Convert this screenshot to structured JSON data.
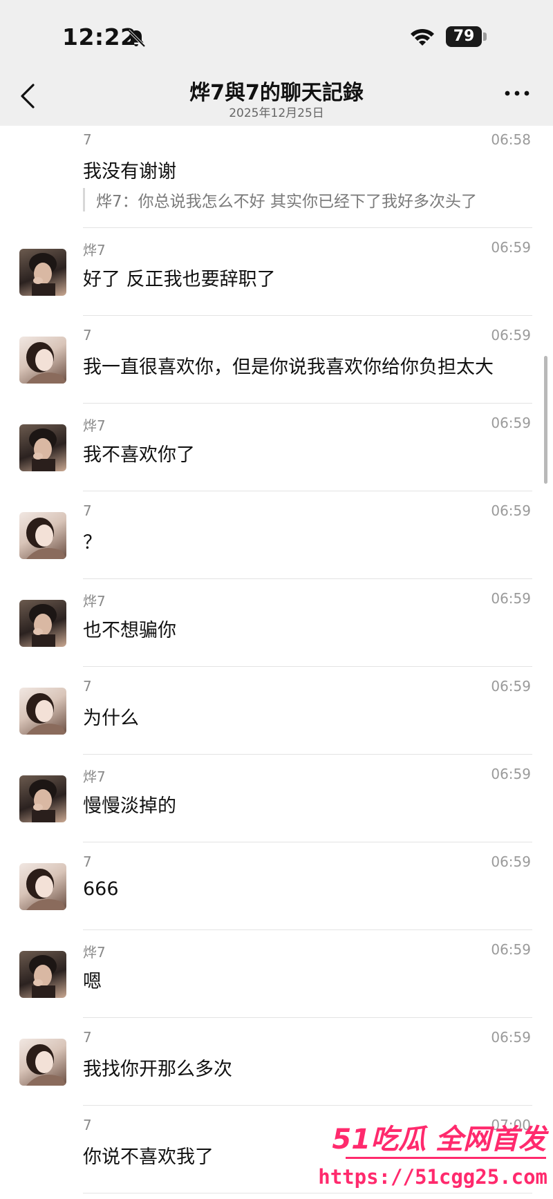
{
  "status_bar": {
    "time": "12:22",
    "battery": "79",
    "icons": [
      "bell-off-icon",
      "wifi-icon",
      "battery-icon"
    ]
  },
  "header": {
    "title": "烨7與7的聊天記錄",
    "date": "2025年12月25日",
    "back_icon": "chevron-left-icon",
    "more_icon": "more-dots-icon"
  },
  "messages": [
    {
      "sender": "7",
      "time": "06:58",
      "text": "我没有谢谢",
      "quote": "烨7：你总说我怎么不好 其实你已经下了我好多次头了",
      "avatar": "none"
    },
    {
      "sender": "烨7",
      "time": "06:59",
      "text": "好了 反正我也要辞职了",
      "avatar": "boy"
    },
    {
      "sender": "7",
      "time": "06:59",
      "text": "我一直很喜欢你，但是你说我喜欢你给你负担太大",
      "avatar": "girl"
    },
    {
      "sender": "烨7",
      "time": "06:59",
      "text": "我不喜欢你了",
      "avatar": "boy"
    },
    {
      "sender": "7",
      "time": "06:59",
      "text": "？",
      "avatar": "girl"
    },
    {
      "sender": "烨7",
      "time": "06:59",
      "text": "也不想骗你",
      "avatar": "boy"
    },
    {
      "sender": "7",
      "time": "06:59",
      "text": "为什么",
      "avatar": "girl"
    },
    {
      "sender": "烨7",
      "time": "06:59",
      "text": "慢慢淡掉的",
      "avatar": "boy"
    },
    {
      "sender": "7",
      "time": "06:59",
      "text": "666",
      "avatar": "girl"
    },
    {
      "sender": "烨7",
      "time": "06:59",
      "text": "嗯",
      "avatar": "boy"
    },
    {
      "sender": "7",
      "time": "06:59",
      "text": "我找你开那么多次",
      "avatar": "girl"
    },
    {
      "sender": "7",
      "time": "07:00",
      "text": "你说不喜欢我了",
      "avatar": "none"
    }
  ],
  "watermark": {
    "brand": "51吃瓜 全网首发",
    "url": "https://51cgg25.com"
  },
  "colors": {
    "header_bg": "#efefef",
    "watermark": "#ff2a6d",
    "meta_text": "#9a9a9a"
  }
}
